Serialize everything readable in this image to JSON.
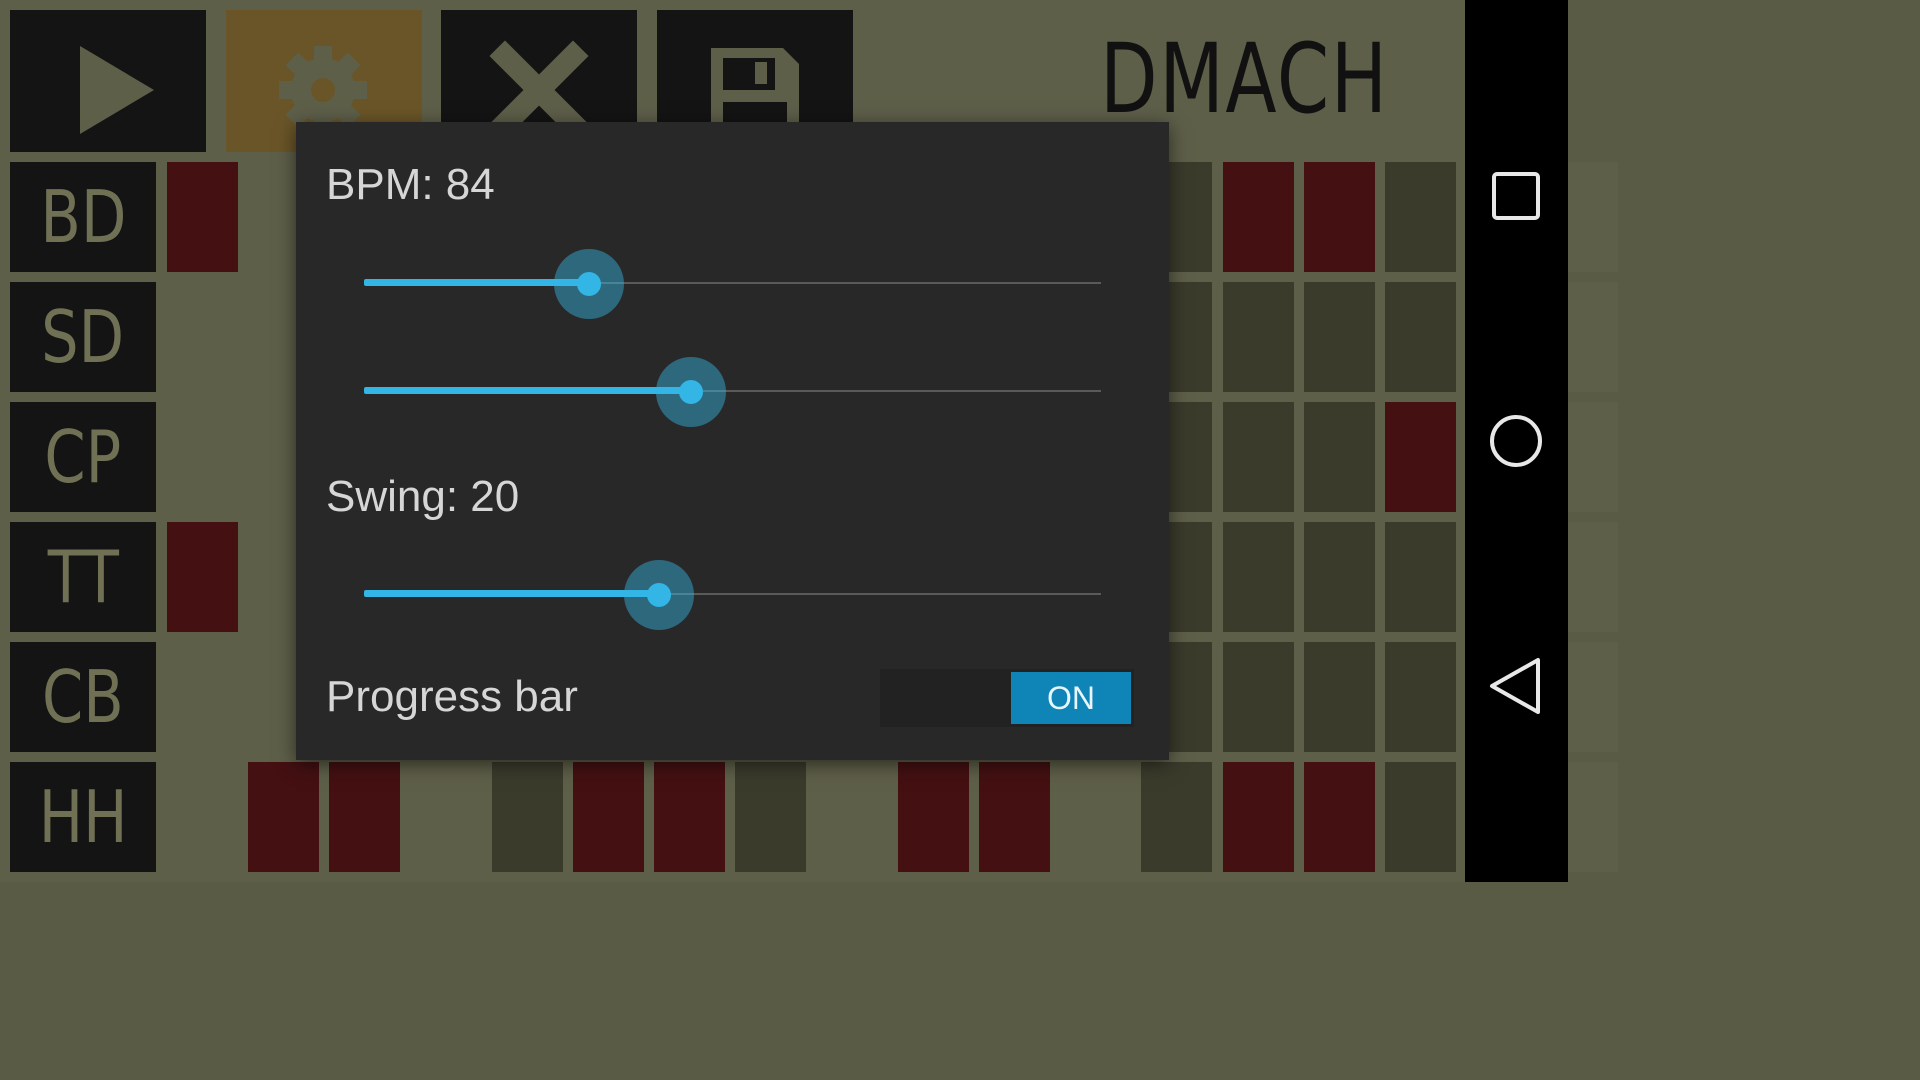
{
  "app": {
    "title": "DMACH",
    "toolbar": [
      {
        "name": "play-button",
        "icon": "play-icon"
      },
      {
        "name": "settings-button",
        "icon": "gear-icon",
        "active": true
      },
      {
        "name": "clear-button",
        "icon": "close-icon"
      },
      {
        "name": "save-button",
        "icon": "save-icon"
      }
    ],
    "tracks": [
      {
        "label": "BD",
        "steps": [
          1,
          0,
          0,
          0,
          0,
          0,
          0,
          0,
          0,
          0,
          0,
          0,
          0,
          1,
          1,
          0,
          0,
          0
        ]
      },
      {
        "label": "SD",
        "steps": [
          0,
          0,
          0,
          0,
          0,
          0,
          0,
          0,
          0,
          0,
          0,
          0,
          0,
          0,
          0,
          0,
          0,
          0
        ]
      },
      {
        "label": "CP",
        "steps": [
          0,
          0,
          0,
          0,
          0,
          0,
          0,
          0,
          0,
          0,
          0,
          0,
          0,
          0,
          0,
          1,
          0,
          0
        ]
      },
      {
        "label": "TT",
        "steps": [
          1,
          0,
          0,
          0,
          0,
          0,
          0,
          0,
          0,
          0,
          0,
          0,
          0,
          0,
          0,
          0,
          0,
          0
        ]
      },
      {
        "label": "CB",
        "steps": [
          0,
          0,
          0,
          0,
          0,
          0,
          0,
          0,
          0,
          0,
          0,
          0,
          0,
          0,
          0,
          0,
          0,
          0
        ]
      },
      {
        "label": "HH",
        "steps": [
          0,
          1,
          1,
          0,
          0,
          1,
          1,
          0,
          0,
          1,
          1,
          0,
          0,
          1,
          1,
          0,
          0,
          0
        ]
      }
    ],
    "colors": {
      "step_on": "#441012",
      "step_off_a": "#5e5f49",
      "step_off_b": "#3b3b2c",
      "accent": "#33b5e5",
      "toggle_on": "#0e84b7"
    }
  },
  "dialog": {
    "bpm_label": "BPM: 84",
    "bpm_slider_fraction": 0.305,
    "second_slider_fraction": 0.444,
    "swing_label": "Swing: 20",
    "swing_slider_fraction": 0.4,
    "progress_label": "Progress bar",
    "progress_toggle": "ON"
  },
  "navbar": {
    "icons": [
      "recents-icon",
      "home-icon",
      "back-icon"
    ]
  }
}
